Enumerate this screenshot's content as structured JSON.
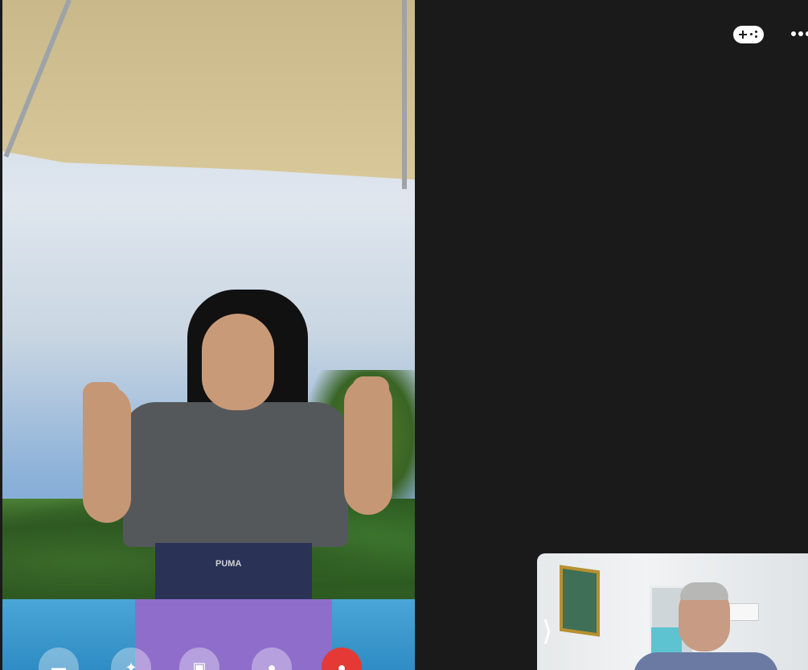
{
  "main_video": {
    "participant": "remote",
    "waistband_text": "PUMA"
  },
  "top_bar": {
    "icons": [
      "gamepad-icon",
      "more-options-icon"
    ]
  },
  "call_controls": {
    "buttons": [
      "menu-button",
      "effects-button",
      "camera-button",
      "microphone-button",
      "end-call-button"
    ],
    "glyphs": [
      "▬",
      "✦",
      "▣",
      "●",
      "●"
    ]
  },
  "self_view": {
    "expand_glyph": "⟩"
  },
  "colors": {
    "background": "#1a1a1a",
    "end_call": "#e53935"
  }
}
